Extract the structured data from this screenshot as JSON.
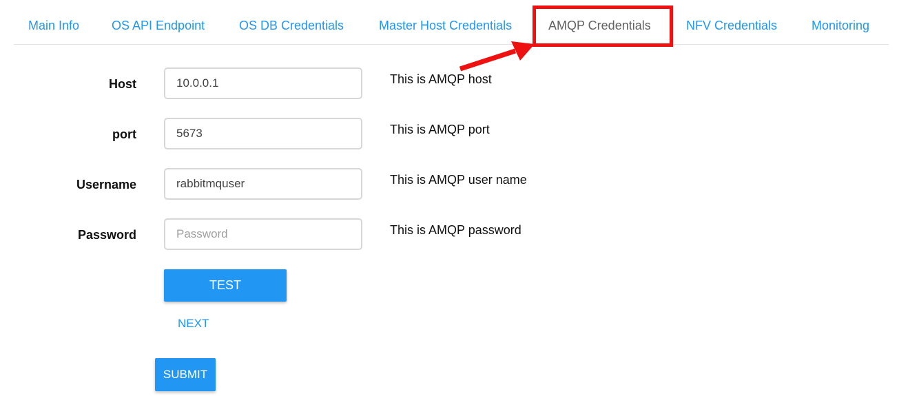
{
  "tabs": [
    {
      "label": "Main Info",
      "active": false
    },
    {
      "label": "OS API Endpoint",
      "active": false
    },
    {
      "label": "OS DB Credentials",
      "active": false
    },
    {
      "label": "Master Host Credentials",
      "active": false
    },
    {
      "label": "AMQP Credentials",
      "active": true
    },
    {
      "label": "NFV Credentials",
      "active": false
    },
    {
      "label": "Monitoring",
      "active": false
    }
  ],
  "form": {
    "host": {
      "label": "Host",
      "value": "10.0.0.1",
      "help": "This is AMQP host"
    },
    "port": {
      "label": "port",
      "value": "5673",
      "help": "This is AMQP port"
    },
    "username": {
      "label": "Username",
      "value": "rabbitmquser",
      "help": "This is AMQP user name"
    },
    "password": {
      "label": "Password",
      "value": "",
      "placeholder": "Password",
      "help": "This is AMQP password"
    }
  },
  "buttons": {
    "test": "TEST",
    "next": "NEXT",
    "submit": "SUBMIT"
  },
  "colors": {
    "accent": "#2196f3",
    "active_tab": "#616161",
    "annotation": "#ee1111"
  }
}
